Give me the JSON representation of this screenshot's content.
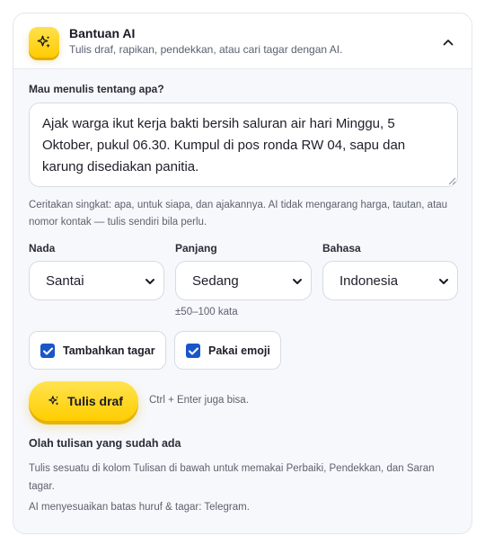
{
  "header": {
    "title": "Bantuan AI",
    "subtitle": "Tulis draf, rapikan, pendekkan, atau cari tagar dengan AI.",
    "badge_icon": "sparkle-icon",
    "collapse_icon": "chevron-up-icon"
  },
  "topic": {
    "label": "Mau menulis tentang apa?",
    "value": "Ajak warga ikut kerja bakti bersih saluran air hari Minggu, 5 Oktober, pukul 06.30. Kumpul di pos ronda RW 04, sapu dan karung disediakan panitia.",
    "hint": "Ceritakan singkat: apa, untuk siapa, dan ajakannya. AI tidak mengarang harga, tautan, atau nomor kontak — tulis sendiri bila perlu."
  },
  "options": {
    "tone": {
      "label": "Nada",
      "value": "Santai"
    },
    "length": {
      "label": "Panjang",
      "value": "Sedang",
      "note": "±50–100 kata"
    },
    "language": {
      "label": "Bahasa",
      "value": "Indonesia"
    }
  },
  "toggles": {
    "hashtags": {
      "label": "Tambahkan tagar",
      "checked": true
    },
    "emoji": {
      "label": "Pakai emoji",
      "checked": true
    }
  },
  "action": {
    "label": "Tulis draf",
    "icon": "sparkle-icon",
    "shortcut": "Ctrl + Enter juga bisa."
  },
  "existing": {
    "title": "Olah tulisan yang sudah ada",
    "text": "Tulis sesuatu di kolom Tulisan di bawah untuk memakai Perbaiki, Pendekkan, dan Saran tagar.",
    "footnote": "AI menyesuaikan batas huruf & tagar: Telegram."
  },
  "colors": {
    "accent_yellow": "#ffcd00",
    "checkbox_blue": "#1a56c8",
    "panel_bg": "#f7f8fb",
    "border": "#d7dbe4"
  }
}
